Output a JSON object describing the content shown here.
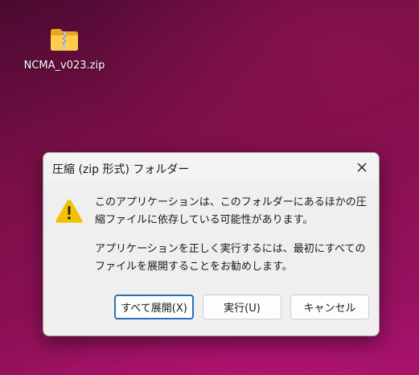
{
  "desktop": {
    "icon_label": "NCMA_v023.zip",
    "icon_name": "zip-folder-icon"
  },
  "dialog": {
    "title": "圧縮 (zip 形式) フォルダー",
    "close_icon": "close-icon",
    "warning_icon": "warning-icon",
    "message_line1": "このアプリケーションは、このフォルダーにあるほかの圧縮ファイルに依存している可能性があります。",
    "message_line2": "アプリケーションを正しく実行するには、最初にすべてのファイルを展開することをお勧めします。",
    "buttons": {
      "extract_all": "すべて展開(X)",
      "run": "実行(U)",
      "cancel": "キャンセル"
    }
  },
  "colors": {
    "accent_border": "#2a6fb8",
    "warning_yellow": "#f2c200"
  }
}
